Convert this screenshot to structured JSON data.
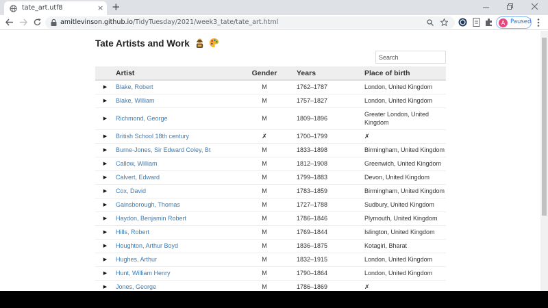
{
  "browser": {
    "tab_title": "tate_art.utf8",
    "tab_close": "×",
    "new_tab": "+",
    "url_host": "amitlevinson.github.io",
    "url_path": "/TidyTuesday/2021/week3_tate/tate_art.html",
    "profile_initial": "A",
    "profile_status": "Paused",
    "profile_color": "#e8457e"
  },
  "page": {
    "title": "Tate Artists and Work",
    "search_placeholder": "Search",
    "link_color": "#3a7cb8"
  },
  "table": {
    "headers": {
      "artist": "Artist",
      "gender": "Gender",
      "years": "Years",
      "place": "Place of birth"
    },
    "expand_glyph": "▶",
    "rows": [
      {
        "artist": "Blake, Robert",
        "gender": "M",
        "years": "1762–1787",
        "place": "London, United Kingdom"
      },
      {
        "artist": "Blake, William",
        "gender": "M",
        "years": "1757–1827",
        "place": "London, United Kingdom"
      },
      {
        "artist": "Richmond, George",
        "gender": "M",
        "years": "1809–1896",
        "place": "Greater London, United Kingdom"
      },
      {
        "artist": "British School 18th century",
        "gender": "✗",
        "years": "1700–1799",
        "place": "✗"
      },
      {
        "artist": "Burne-Jones, Sir Edward Coley, Bt",
        "gender": "M",
        "years": "1833–1898",
        "place": "Birmingham, United Kingdom"
      },
      {
        "artist": "Callow, William",
        "gender": "M",
        "years": "1812–1908",
        "place": "Greenwich, United Kingdom"
      },
      {
        "artist": "Calvert, Edward",
        "gender": "M",
        "years": "1799–1883",
        "place": "Devon, United Kingdom"
      },
      {
        "artist": "Cox, David",
        "gender": "M",
        "years": "1783–1859",
        "place": "Birmingham, United Kingdom"
      },
      {
        "artist": "Gainsborough, Thomas",
        "gender": "M",
        "years": "1727–1788",
        "place": "Sudbury, United Kingdom"
      },
      {
        "artist": "Haydon, Benjamin Robert",
        "gender": "M",
        "years": "1786–1846",
        "place": "Plymouth, United Kingdom"
      },
      {
        "artist": "Hills, Robert",
        "gender": "M",
        "years": "1769–1844",
        "place": "Islington, United Kingdom"
      },
      {
        "artist": "Houghton, Arthur Boyd",
        "gender": "M",
        "years": "1836–1875",
        "place": "Kotagiri, Bharat"
      },
      {
        "artist": "Hughes, Arthur",
        "gender": "M",
        "years": "1832–1915",
        "place": "London, United Kingdom"
      },
      {
        "artist": "Hunt, William Henry",
        "gender": "M",
        "years": "1790–1864",
        "place": "London, United Kingdom"
      },
      {
        "artist": "Jones, George",
        "gender": "M",
        "years": "1786–1869",
        "place": "✗"
      }
    ]
  }
}
